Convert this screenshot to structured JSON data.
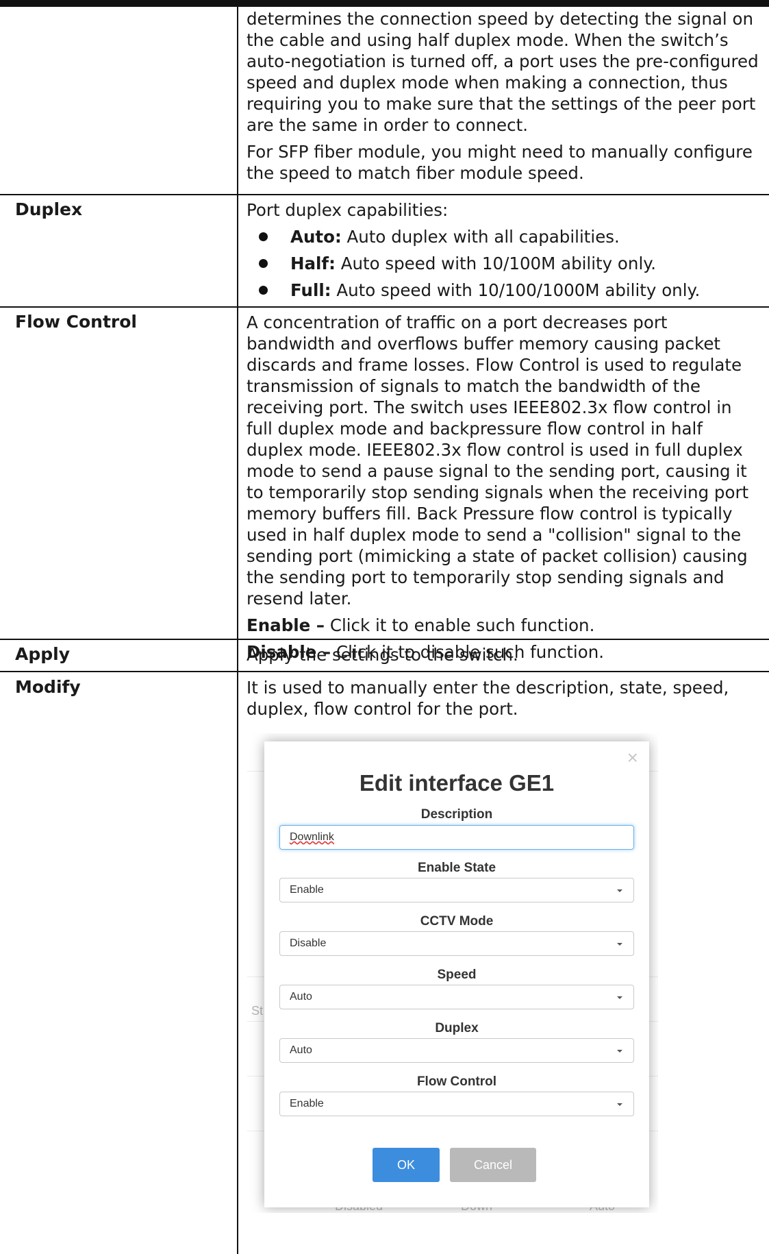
{
  "intro": {
    "p1": "determines the connection speed by detecting the signal on the cable and using half duplex mode. When the switch’s auto-negotiation is turned off, a port uses the pre-configured speed and duplex mode when making a connection, thus requiring you to make sure that the settings of the peer port are the same in order to connect.",
    "p2": "For SFP fiber module, you might need to manually configure the speed to match fiber module speed."
  },
  "duplex": {
    "label": "Duplex",
    "intro": "Port duplex capabilities:",
    "items": [
      {
        "term": "Auto:",
        "text": " Auto duplex with all capabilities."
      },
      {
        "term": "Half:",
        "text": " Auto speed with 10/100M ability only."
      },
      {
        "term": "Full:",
        "text": " Auto speed with 10/100/1000M ability only."
      }
    ]
  },
  "flow": {
    "label": "Flow Control",
    "text": "A concentration of traffic on a port decreases port bandwidth and overflows buffer memory causing packet discards and frame losses. Flow Control is used to regulate transmission of signals to match the bandwidth of the receiving port. The switch uses IEEE802.3x flow control in full duplex mode and backpressure flow control in half duplex mode. IEEE802.3x flow control is used in full duplex mode to send a pause signal to the sending port, causing it to temporarily stop sending signals when the receiving port memory buffers fill. Back Pressure flow control is typically used in half duplex mode to send a \"collision\" signal to the sending port (mimicking a state of packet collision) causing the sending port to temporarily stop sending signals and resend later.",
    "enable_term": "Enable –",
    "enable_text": " Click it to enable such function.",
    "disable_term": "Disable –",
    "disable_text": " Click it to disable such function."
  },
  "apply": {
    "label": "Apply",
    "text": "Apply the settings to the switch."
  },
  "modify": {
    "label": "Modify",
    "text": "It is used to manually enter the description, state, speed, duplex, flow control for the port."
  },
  "dialog": {
    "close": "×",
    "title": "Edit interface GE1",
    "description_label": "Description",
    "description_value": "Downlink",
    "enable_state_label": "Enable State",
    "enable_state_value": "Enable",
    "cctv_label": "CCTV Mode",
    "cctv_value": "Disable",
    "speed_label": "Speed",
    "speed_value": "Auto",
    "duplex_label": "Duplex",
    "duplex_value": "Auto",
    "flow_label": "Flow Control",
    "flow_value": "Enable",
    "ok": "OK",
    "cancel": "Cancel"
  },
  "background": {
    "frag1": "St",
    "frag2": "Disabled",
    "frag3": "Down",
    "frag4": "Auto"
  }
}
